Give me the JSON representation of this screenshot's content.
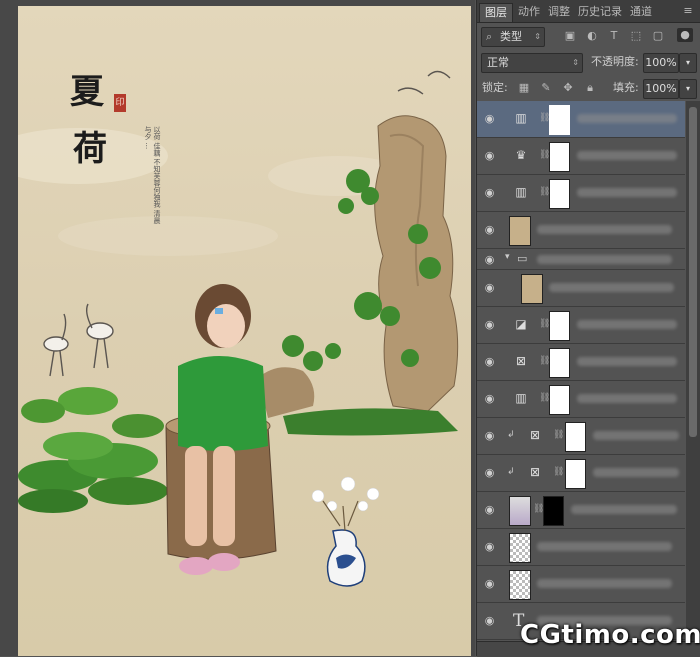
{
  "canvas": {
    "title_chars": [
      "夏",
      "荷"
    ],
    "poem_text": "以荷 佳藕 不知芙蓉何独我 清晨与夕 …",
    "seal": "印"
  },
  "panel": {
    "tabs": [
      "图层",
      "动作",
      "调整",
      "历史记录",
      "通道"
    ],
    "menu_icon": "panel-menu-icon",
    "filter": {
      "label": "类型"
    },
    "blend_mode": "正常",
    "opacity_label": "不透明度:",
    "opacity_value": "100%",
    "lock_label": "锁定:",
    "fill_label": "填充:",
    "fill_value": "100%"
  },
  "layers": [
    {
      "type": "levels",
      "selected": true
    },
    {
      "type": "curves"
    },
    {
      "type": "levels"
    },
    {
      "type": "image-paper"
    },
    {
      "type": "group"
    },
    {
      "type": "image-paper"
    },
    {
      "type": "curves-adj"
    },
    {
      "type": "hue"
    },
    {
      "type": "levels"
    },
    {
      "type": "clip-hue"
    },
    {
      "type": "clip-hue"
    },
    {
      "type": "photo-mask"
    },
    {
      "type": "transparent"
    },
    {
      "type": "transparent"
    },
    {
      "type": "text",
      "glyph": "T"
    }
  ],
  "watermark": "CGtimo.com",
  "colors": {
    "panel_bg": "#535353",
    "selected": "#5b6a80",
    "canvas_paper": "#dccfb1",
    "dress_green": "#2e9a3a"
  }
}
